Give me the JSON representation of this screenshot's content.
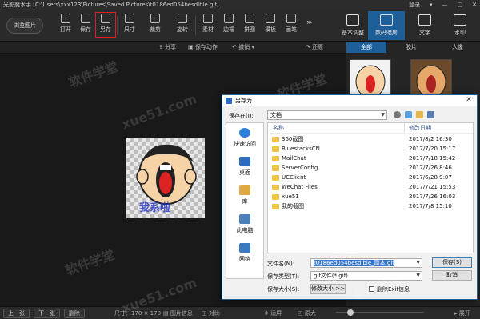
{
  "titlebar": {
    "app_title": "光影魔术手 [C:\\Users\\xxx123\\Pictures\\Saved Pictures\\t0186ed054besdlble.gif]",
    "login_label": "登录",
    "controls": [
      "▾",
      "—",
      "□",
      "✕"
    ]
  },
  "toolbar": {
    "browse_label": "浏览图片",
    "buttons": [
      "打开",
      "保存",
      "另存",
      "尺寸",
      "裁剪",
      "旋转",
      "素材",
      "边框",
      "拼图",
      "模板",
      "画笔"
    ],
    "more_label": "≫",
    "right_tabs": [
      "基本调整",
      "数码暗房",
      "文字",
      "水印"
    ]
  },
  "subbar": {
    "share": "分享",
    "save_action": "保存动作",
    "undo": "撤销",
    "redo": "还原"
  },
  "right_panel": {
    "tabs": [
      "全部",
      "胶片",
      "人像"
    ]
  },
  "photo": {
    "caption": "我系啦"
  },
  "statusbar": {
    "prev": "上一张",
    "next": "下一张",
    "delete": "删除",
    "size_text": "尺寸：170 × 170",
    "info": "图片信息",
    "compare": "对比",
    "fit": "适屏",
    "original": "原大",
    "expand": "展开"
  },
  "dialog": {
    "title": "另存为",
    "close": "✕",
    "save_in_label": "保存在(I):",
    "save_in_value": "文档",
    "places": [
      "快速访问",
      "桌面",
      "库",
      "此电脑",
      "网络"
    ],
    "columns": {
      "name": "名称",
      "date": "修改日期"
    },
    "files": [
      {
        "name": "360截图",
        "date": "2017/8/2 16:30"
      },
      {
        "name": "BluestacksCN",
        "date": "2017/7/20 15:17"
      },
      {
        "name": "MailChat",
        "date": "2017/7/18 15:42"
      },
      {
        "name": "ServerConfig",
        "date": "2017/7/26 8:46"
      },
      {
        "name": "UCClient",
        "date": "2017/6/28 9:07"
      },
      {
        "name": "WeChat Files",
        "date": "2017/7/21 15:53"
      },
      {
        "name": "xue51",
        "date": "2017/7/26 16:03"
      },
      {
        "name": "我的截图",
        "date": "2017/7/8 15:10"
      }
    ],
    "filename_label": "文件名(N):",
    "filename_value": "t0186ed054besdlble_副本.gif",
    "filetype_label": "保存类型(T):",
    "filetype_value": "gif文件(*.gif)",
    "filesize_label": "保存大小(S):",
    "filesize_button": "修改大小 >>",
    "exif_label": "删除Exif信息",
    "save_button": "保存(S)",
    "cancel_button": "取消"
  },
  "watermarks": [
    "软件学堂",
    "xue51.com"
  ]
}
